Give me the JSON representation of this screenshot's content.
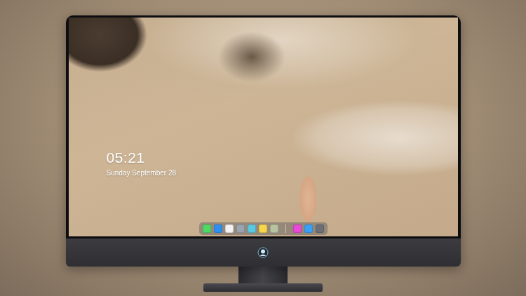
{
  "screen": {
    "clock": {
      "time": "05:21",
      "date": "Sunday September 28"
    },
    "dock": {
      "items": [
        {
          "kind": "app",
          "color": "#4cd964"
        },
        {
          "kind": "app",
          "color": "#2f8ff0"
        },
        {
          "kind": "app",
          "color": "#f2f2f2"
        },
        {
          "kind": "app",
          "color": "#9aa4ae"
        },
        {
          "kind": "app",
          "color": "#5ac8e0"
        },
        {
          "kind": "app",
          "color": "#f7d64a"
        },
        {
          "kind": "app",
          "color": "#b8c4a0"
        },
        {
          "kind": "separator"
        },
        {
          "kind": "app",
          "color": "#e64ad6"
        },
        {
          "kind": "app",
          "color": "#3aa0f5"
        },
        {
          "kind": "app",
          "color": "#6d6f75"
        }
      ]
    }
  }
}
